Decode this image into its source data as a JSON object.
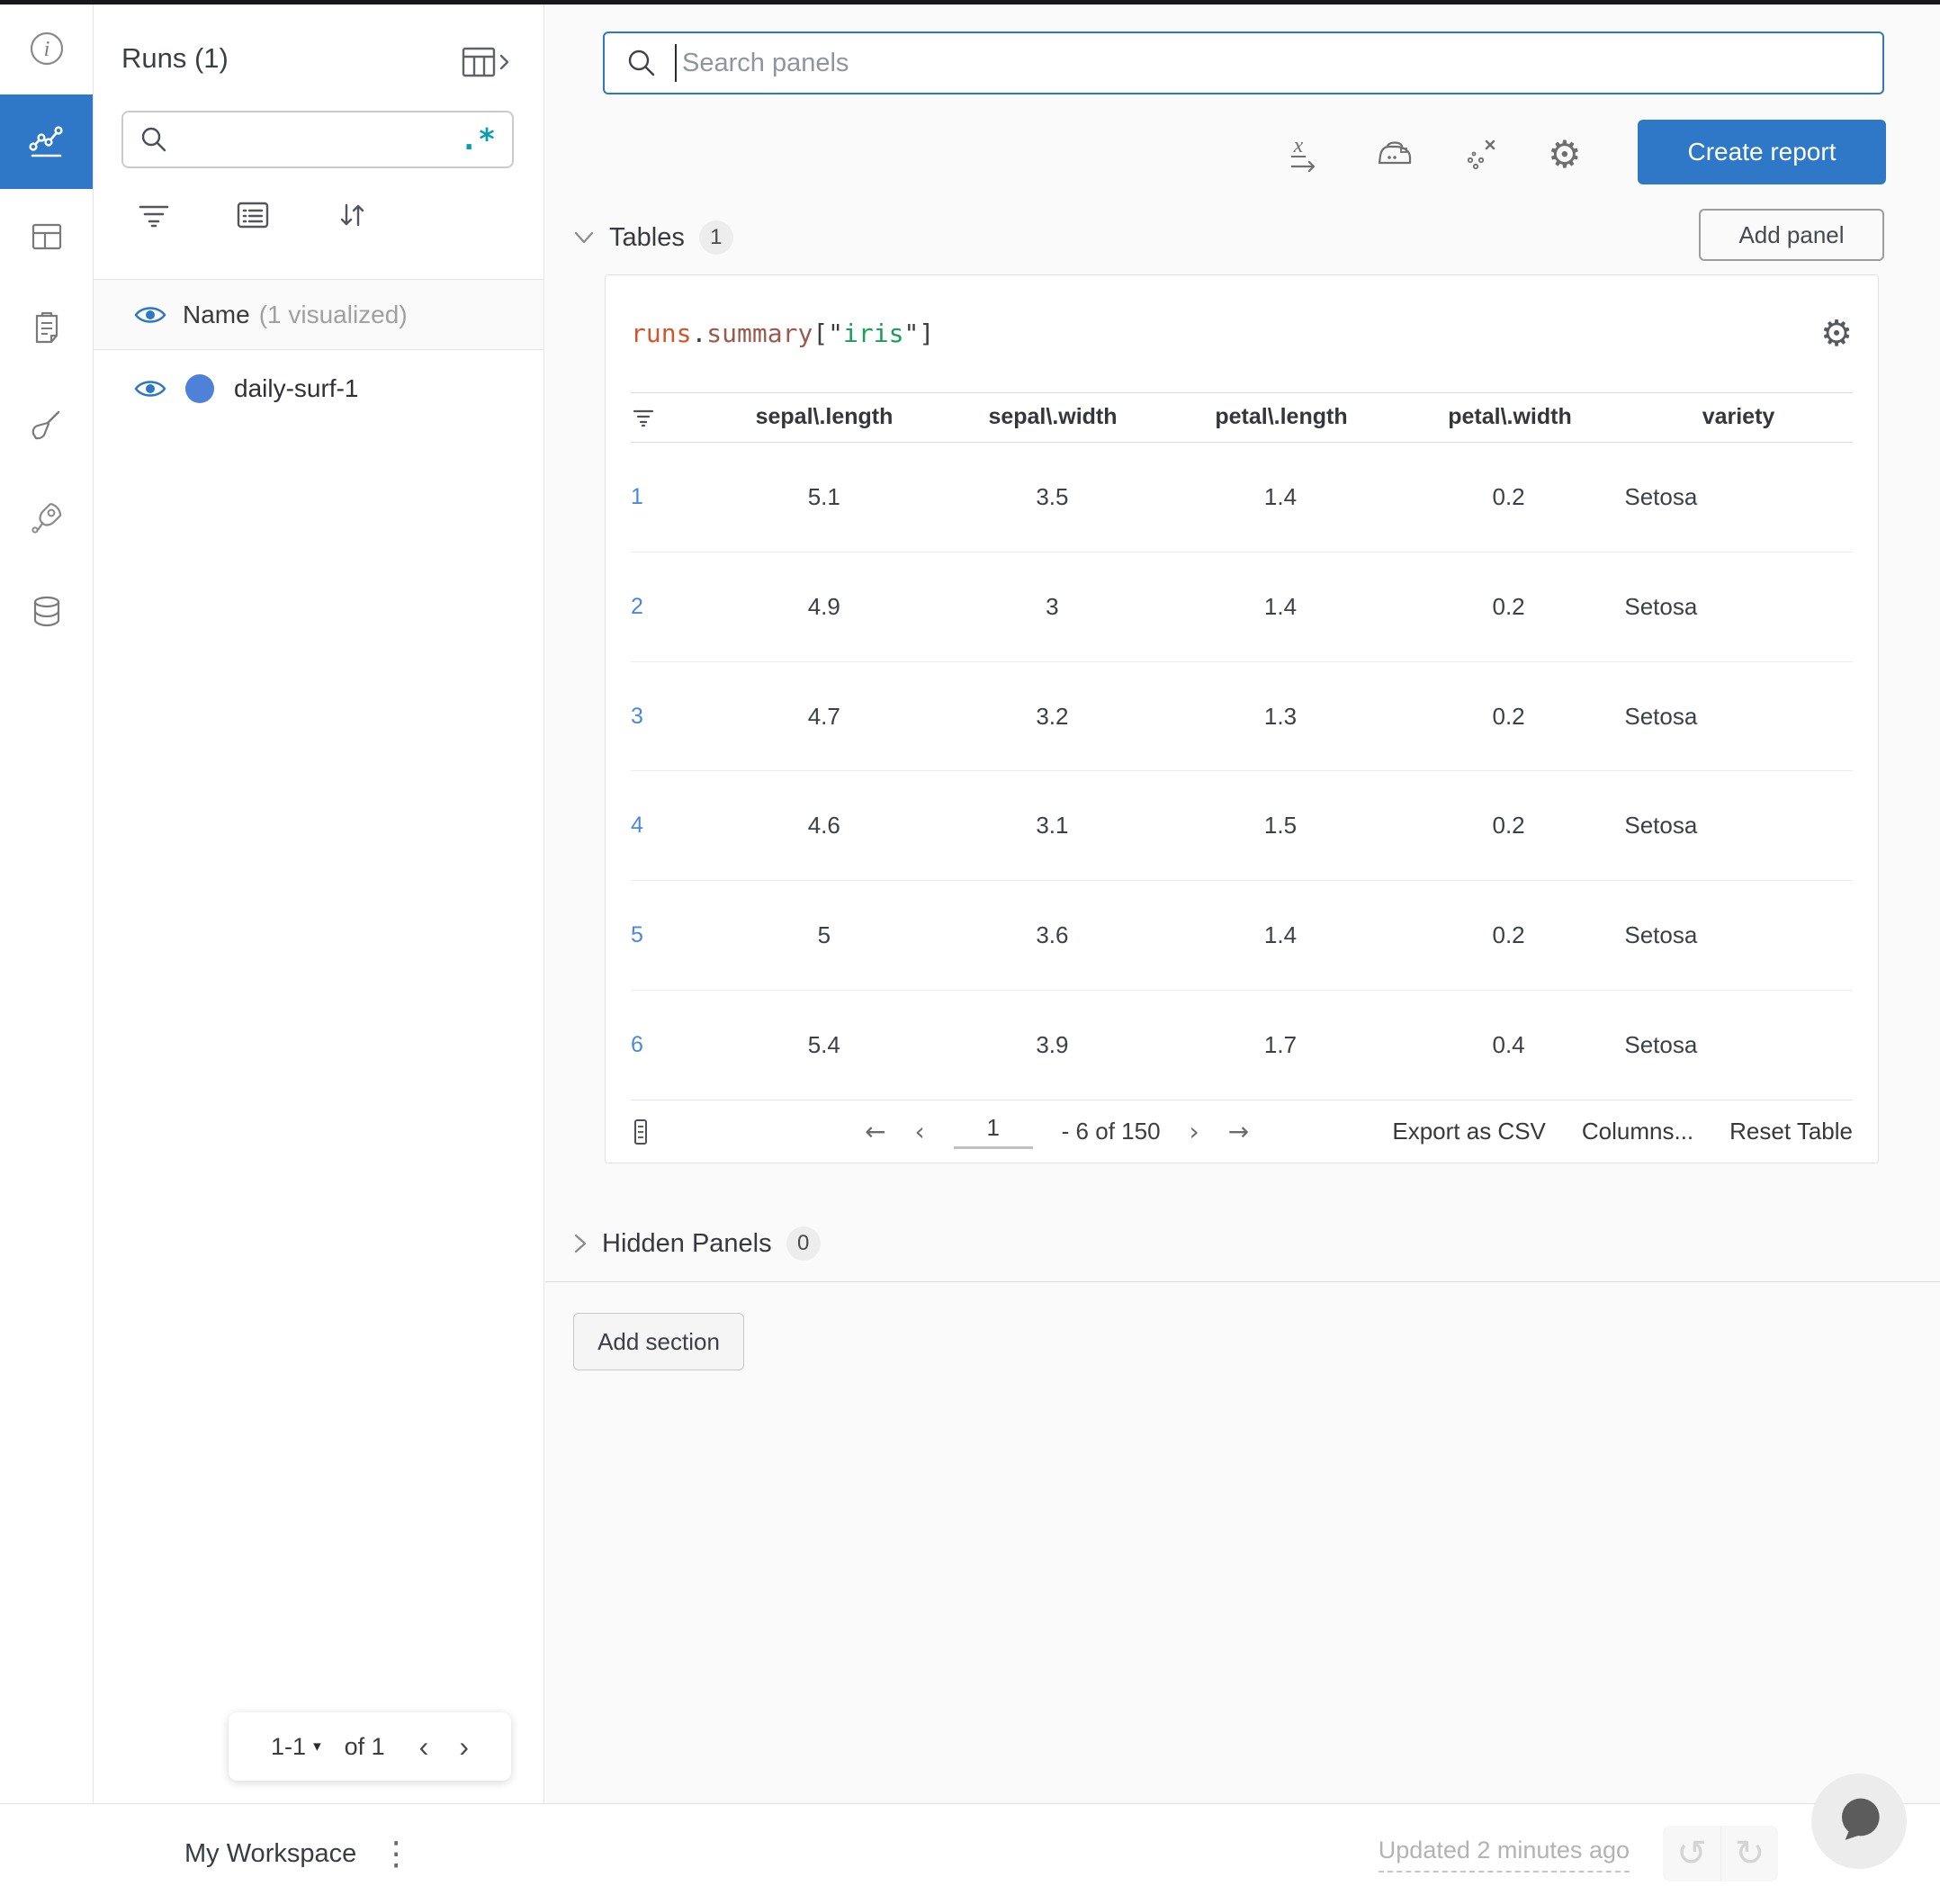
{
  "colors": {
    "accent_blue": "#2e78c7",
    "run_dot_blue": "#4e82d8",
    "link_blue": "#4b87dd",
    "regex_teal": "#0c9eb0",
    "code_runs": "#d4552c",
    "code_summary": "#9a5b4f",
    "code_punct": "#3d3d3d",
    "code_string": "#199f57"
  },
  "glyphs": {
    "gear": "⚙",
    "kebab": "⋮",
    "undo": "↺",
    "redo": "↻",
    "dropdown": "▾",
    "chevron_left": "‹",
    "chevron_right": "›",
    "arrow_left": "←",
    "arrow_right": "→"
  },
  "rail": {
    "icons": [
      "info-icon",
      "line-chart-icon",
      "panels-icon",
      "clipboard-icon",
      "broom-icon",
      "rocket-icon",
      "database-icon"
    ],
    "active_icon": "line-chart-icon"
  },
  "runs_panel": {
    "title": "Runs (1)",
    "search": {
      "placeholder": "",
      "regex_glyph": ".*"
    },
    "list_header": {
      "label": "Name",
      "annotation": "(1 visualized)"
    },
    "runs": [
      {
        "name": "daily-surf-1"
      }
    ],
    "pagination": {
      "range": "1-1",
      "of_label": "of 1"
    }
  },
  "main": {
    "panel_search": {
      "placeholder": "Search panels"
    },
    "create_report_label": "Create report",
    "tables_section": {
      "label": "Tables",
      "count": "1",
      "add_panel_label": "Add panel"
    },
    "hidden_section": {
      "label": "Hidden Panels",
      "count": "0"
    },
    "add_section_label": "Add section"
  },
  "table_panel": {
    "expression": [
      {
        "text": "runs"
      },
      {
        "text": "."
      },
      {
        "text": "summary"
      },
      {
        "text": "[\""
      },
      {
        "text": "iris"
      },
      {
        "text": "\"]"
      }
    ],
    "columns": [
      "sepal\\.length",
      "sepal\\.width",
      "petal\\.length",
      "petal\\.width",
      "variety"
    ],
    "rows": [
      {
        "index": "1",
        "sepal_length": "5.1",
        "sepal_width": "3.5",
        "petal_length": "1.4",
        "petal_width": "0.2",
        "variety": "Setosa"
      },
      {
        "index": "2",
        "sepal_length": "4.9",
        "sepal_width": "3",
        "petal_length": "1.4",
        "petal_width": "0.2",
        "variety": "Setosa"
      },
      {
        "index": "3",
        "sepal_length": "4.7",
        "sepal_width": "3.2",
        "petal_length": "1.3",
        "petal_width": "0.2",
        "variety": "Setosa"
      },
      {
        "index": "4",
        "sepal_length": "4.6",
        "sepal_width": "3.1",
        "petal_length": "1.5",
        "petal_width": "0.2",
        "variety": "Setosa"
      },
      {
        "index": "5",
        "sepal_length": "5",
        "sepal_width": "3.6",
        "petal_length": "1.4",
        "petal_width": "0.2",
        "variety": "Setosa"
      },
      {
        "index": "6",
        "sepal_length": "5.4",
        "sepal_width": "3.9",
        "petal_length": "1.7",
        "petal_width": "0.4",
        "variety": "Setosa"
      }
    ],
    "footer": {
      "page_value": "1",
      "range_label": "- 6 of 150",
      "export_label": "Export as CSV",
      "columns_label": "Columns...",
      "reset_label": "Reset Table"
    }
  },
  "statusbar": {
    "workspace_label": "My Workspace",
    "updated_label": "Updated 2 minutes ago"
  }
}
